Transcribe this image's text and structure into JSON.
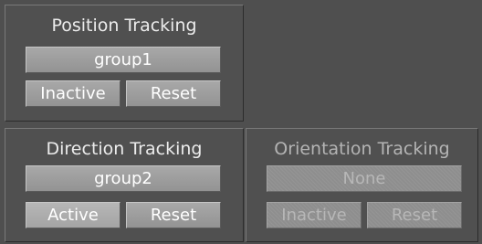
{
  "position_tracking": {
    "title": "Position Tracking",
    "group_value": "group1",
    "state_label": "Inactive",
    "reset_label": "Reset"
  },
  "direction_tracking": {
    "title": "Direction Tracking",
    "group_value": "group2",
    "state_label": "Active",
    "reset_label": "Reset"
  },
  "orientation_tracking": {
    "title": "Orientation Tracking",
    "group_value": "None",
    "state_label": "Inactive",
    "reset_label": "Reset",
    "enabled": false
  },
  "colors": {
    "background": "#4f4f4f",
    "button": "#9f9f9f",
    "text": "#ffffff",
    "disabled_text": "#b7b7b7"
  }
}
